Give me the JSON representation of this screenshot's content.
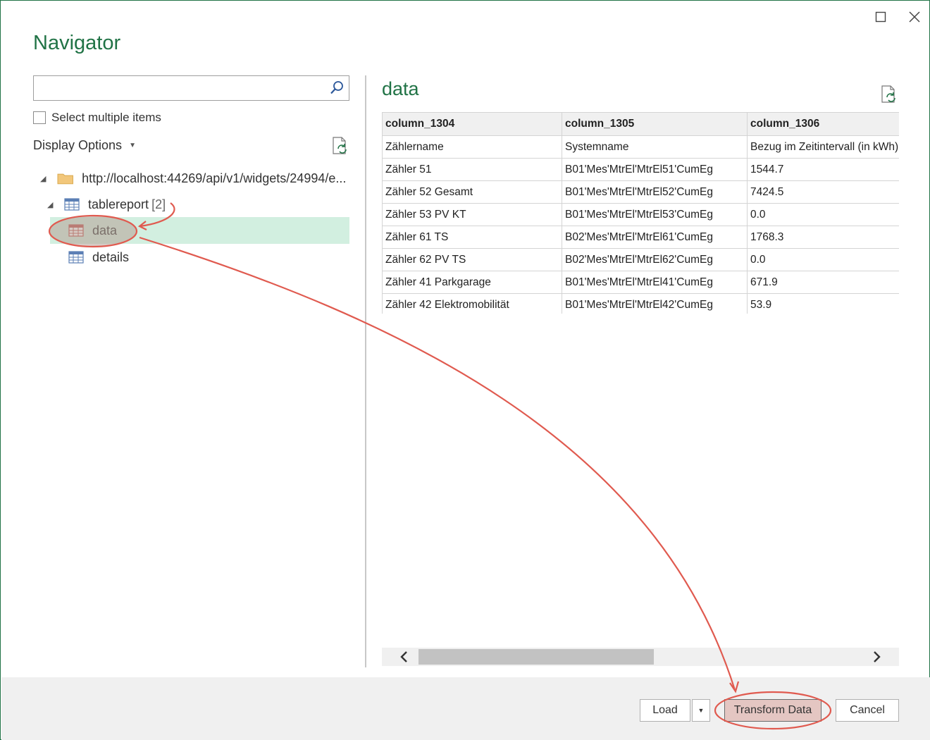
{
  "navigator": {
    "title": "Navigator",
    "search": {
      "value": "",
      "placeholder": ""
    },
    "select_multiple_label": "Select multiple items",
    "display_options_label": "Display Options",
    "tree": {
      "root": {
        "label": "http://localhost:44269/api/v1/widgets/24994/e..."
      },
      "tablereport": {
        "label": "tablereport",
        "count": "[2]"
      },
      "children": [
        {
          "label": "data"
        },
        {
          "label": "details"
        }
      ]
    }
  },
  "preview": {
    "title": "data",
    "columns": [
      "column_1304",
      "column_1305",
      "column_1306"
    ],
    "rows": [
      [
        "Zählername",
        "Systemname",
        "Bezug im Zeitintervall (in kWh)"
      ],
      [
        "Zähler 51",
        "B01'Mes'MtrEl'MtrEl51'CumEg",
        "1544.7"
      ],
      [
        "Zähler 52 Gesamt",
        "B01'Mes'MtrEl'MtrEl52'CumEg",
        "7424.5"
      ],
      [
        "Zähler 53 PV KT",
        "B01'Mes'MtrEl'MtrEl53'CumEg",
        "0.0"
      ],
      [
        "Zähler 61 TS",
        "B02'Mes'MtrEl'MtrEl61'CumEg",
        "1768.3"
      ],
      [
        "Zähler 62 PV TS",
        "B02'Mes'MtrEl'MtrEl62'CumEg",
        "0.0"
      ],
      [
        "Zähler 41 Parkgarage",
        "B01'Mes'MtrEl'MtrEl41'CumEg",
        "671.9"
      ],
      [
        "Zähler 42 Elektromobilität",
        "B01'Mes'MtrEl'MtrEl42'CumEg",
        "53.9"
      ]
    ]
  },
  "footer": {
    "load_label": "Load",
    "transform_label": "Transform Data",
    "cancel_label": "Cancel"
  },
  "colors": {
    "accent": "#217346",
    "selected_row": "#d2efe0",
    "annotation": "#e05a4f"
  }
}
